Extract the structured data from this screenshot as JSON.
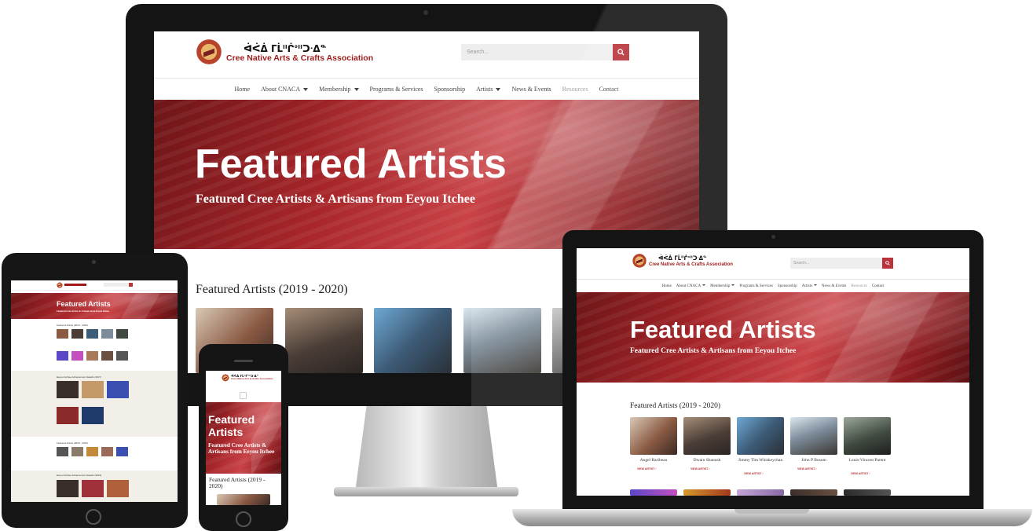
{
  "site": {
    "syllabics": "ᐋᐹᐄ ᒥᒫᐦᒌᐤᐦᑐᐧᐃᓐ",
    "org_name": "Cree Native Arts & Crafts Association",
    "org_short": "CNACA",
    "search_placeholder": "Search...",
    "search_icon": "search-icon",
    "accent_color": "#b8333a",
    "nav": [
      {
        "label": "Home",
        "dropdown": false,
        "muted": false
      },
      {
        "label": "About CNACA",
        "dropdown": true,
        "muted": false
      },
      {
        "label": "Membership",
        "dropdown": true,
        "muted": false
      },
      {
        "label": "Programs & Services",
        "dropdown": false,
        "muted": false
      },
      {
        "label": "Sponsorship",
        "dropdown": false,
        "muted": false
      },
      {
        "label": "Artists",
        "dropdown": true,
        "muted": false
      },
      {
        "label": "News & Events",
        "dropdown": false,
        "muted": false
      },
      {
        "label": "Resources",
        "dropdown": false,
        "muted": true
      },
      {
        "label": "Contact",
        "dropdown": false,
        "muted": false
      }
    ],
    "hero_title": "Featured Artists",
    "hero_subtitle": "Featured Cree Artists & Artisans from Eeyou Itchee",
    "section_title": "Featured Artists (2019 - 2020)",
    "artists": [
      {
        "name": "Angel Baribeau",
        "link": "VIEW ARTIST ›"
      },
      {
        "name": "Dwain Shanush",
        "link": "VIEW ARTIST ›"
      },
      {
        "name": "Jimmy Tim Whiskeychan",
        "link": "VIEW ARTIST ›"
      },
      {
        "name": "John P Bosum",
        "link": "VIEW ARTIST ›"
      },
      {
        "name": "Louis-Vincent Parent",
        "link": "VIEW ARTIST ›"
      }
    ]
  },
  "tablet": {
    "sections": [
      "Featured Artists (2019 - 2020)",
      "Eeyou Istchee Achievement Awards (2017)",
      "Featured Artists (2018 - 2019)",
      "Eeyou Istchee Achievement Awards (2019)"
    ]
  },
  "phone": {
    "hero_title": "Featured Artists",
    "hero_subtitle": "Featured Cree Artists & Artisans from Eeyou Itchee",
    "section_title": "Featured Artists (2019 - 2020)"
  }
}
